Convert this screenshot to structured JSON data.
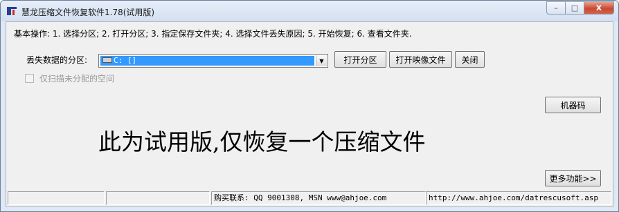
{
  "window": {
    "title": "慧龙压缩文件恢复软件1.78(试用版)",
    "controls": {
      "minimize": "–",
      "maximize": "□",
      "close": "x"
    }
  },
  "steps_text": "基本操作: 1. 选择分区; 2. 打开分区; 3. 指定保存文件夹; 4. 选择文件丢失原因; 5. 开始恢复; 6. 查看文件夹.",
  "partition": {
    "label": "丢失数据的分区:",
    "selected_value": "C: []",
    "icon": "drive-icon"
  },
  "buttons": {
    "open_partition": "打开分区",
    "open_image": "打开映像文件",
    "close": "关闭",
    "machine_code": "机器码",
    "more_features": "更多功能>>"
  },
  "options": {
    "scan_unallocated_label": "仅扫描未分配的空间",
    "scan_unallocated_checked": false,
    "scan_unallocated_enabled": false
  },
  "notice": "此为试用版,仅恢复一个压缩文件",
  "statusbar": {
    "pane1": "",
    "pane2": "",
    "contact": "购买联系: QQ 9001308, MSN www@ahjoe.com",
    "url": "http://www.ahjoe.com/datrescusoft.asp"
  },
  "colors": {
    "selection": "#3399ff",
    "title_gradient_top": "#e6eef9",
    "close_button": "#c74a33"
  }
}
